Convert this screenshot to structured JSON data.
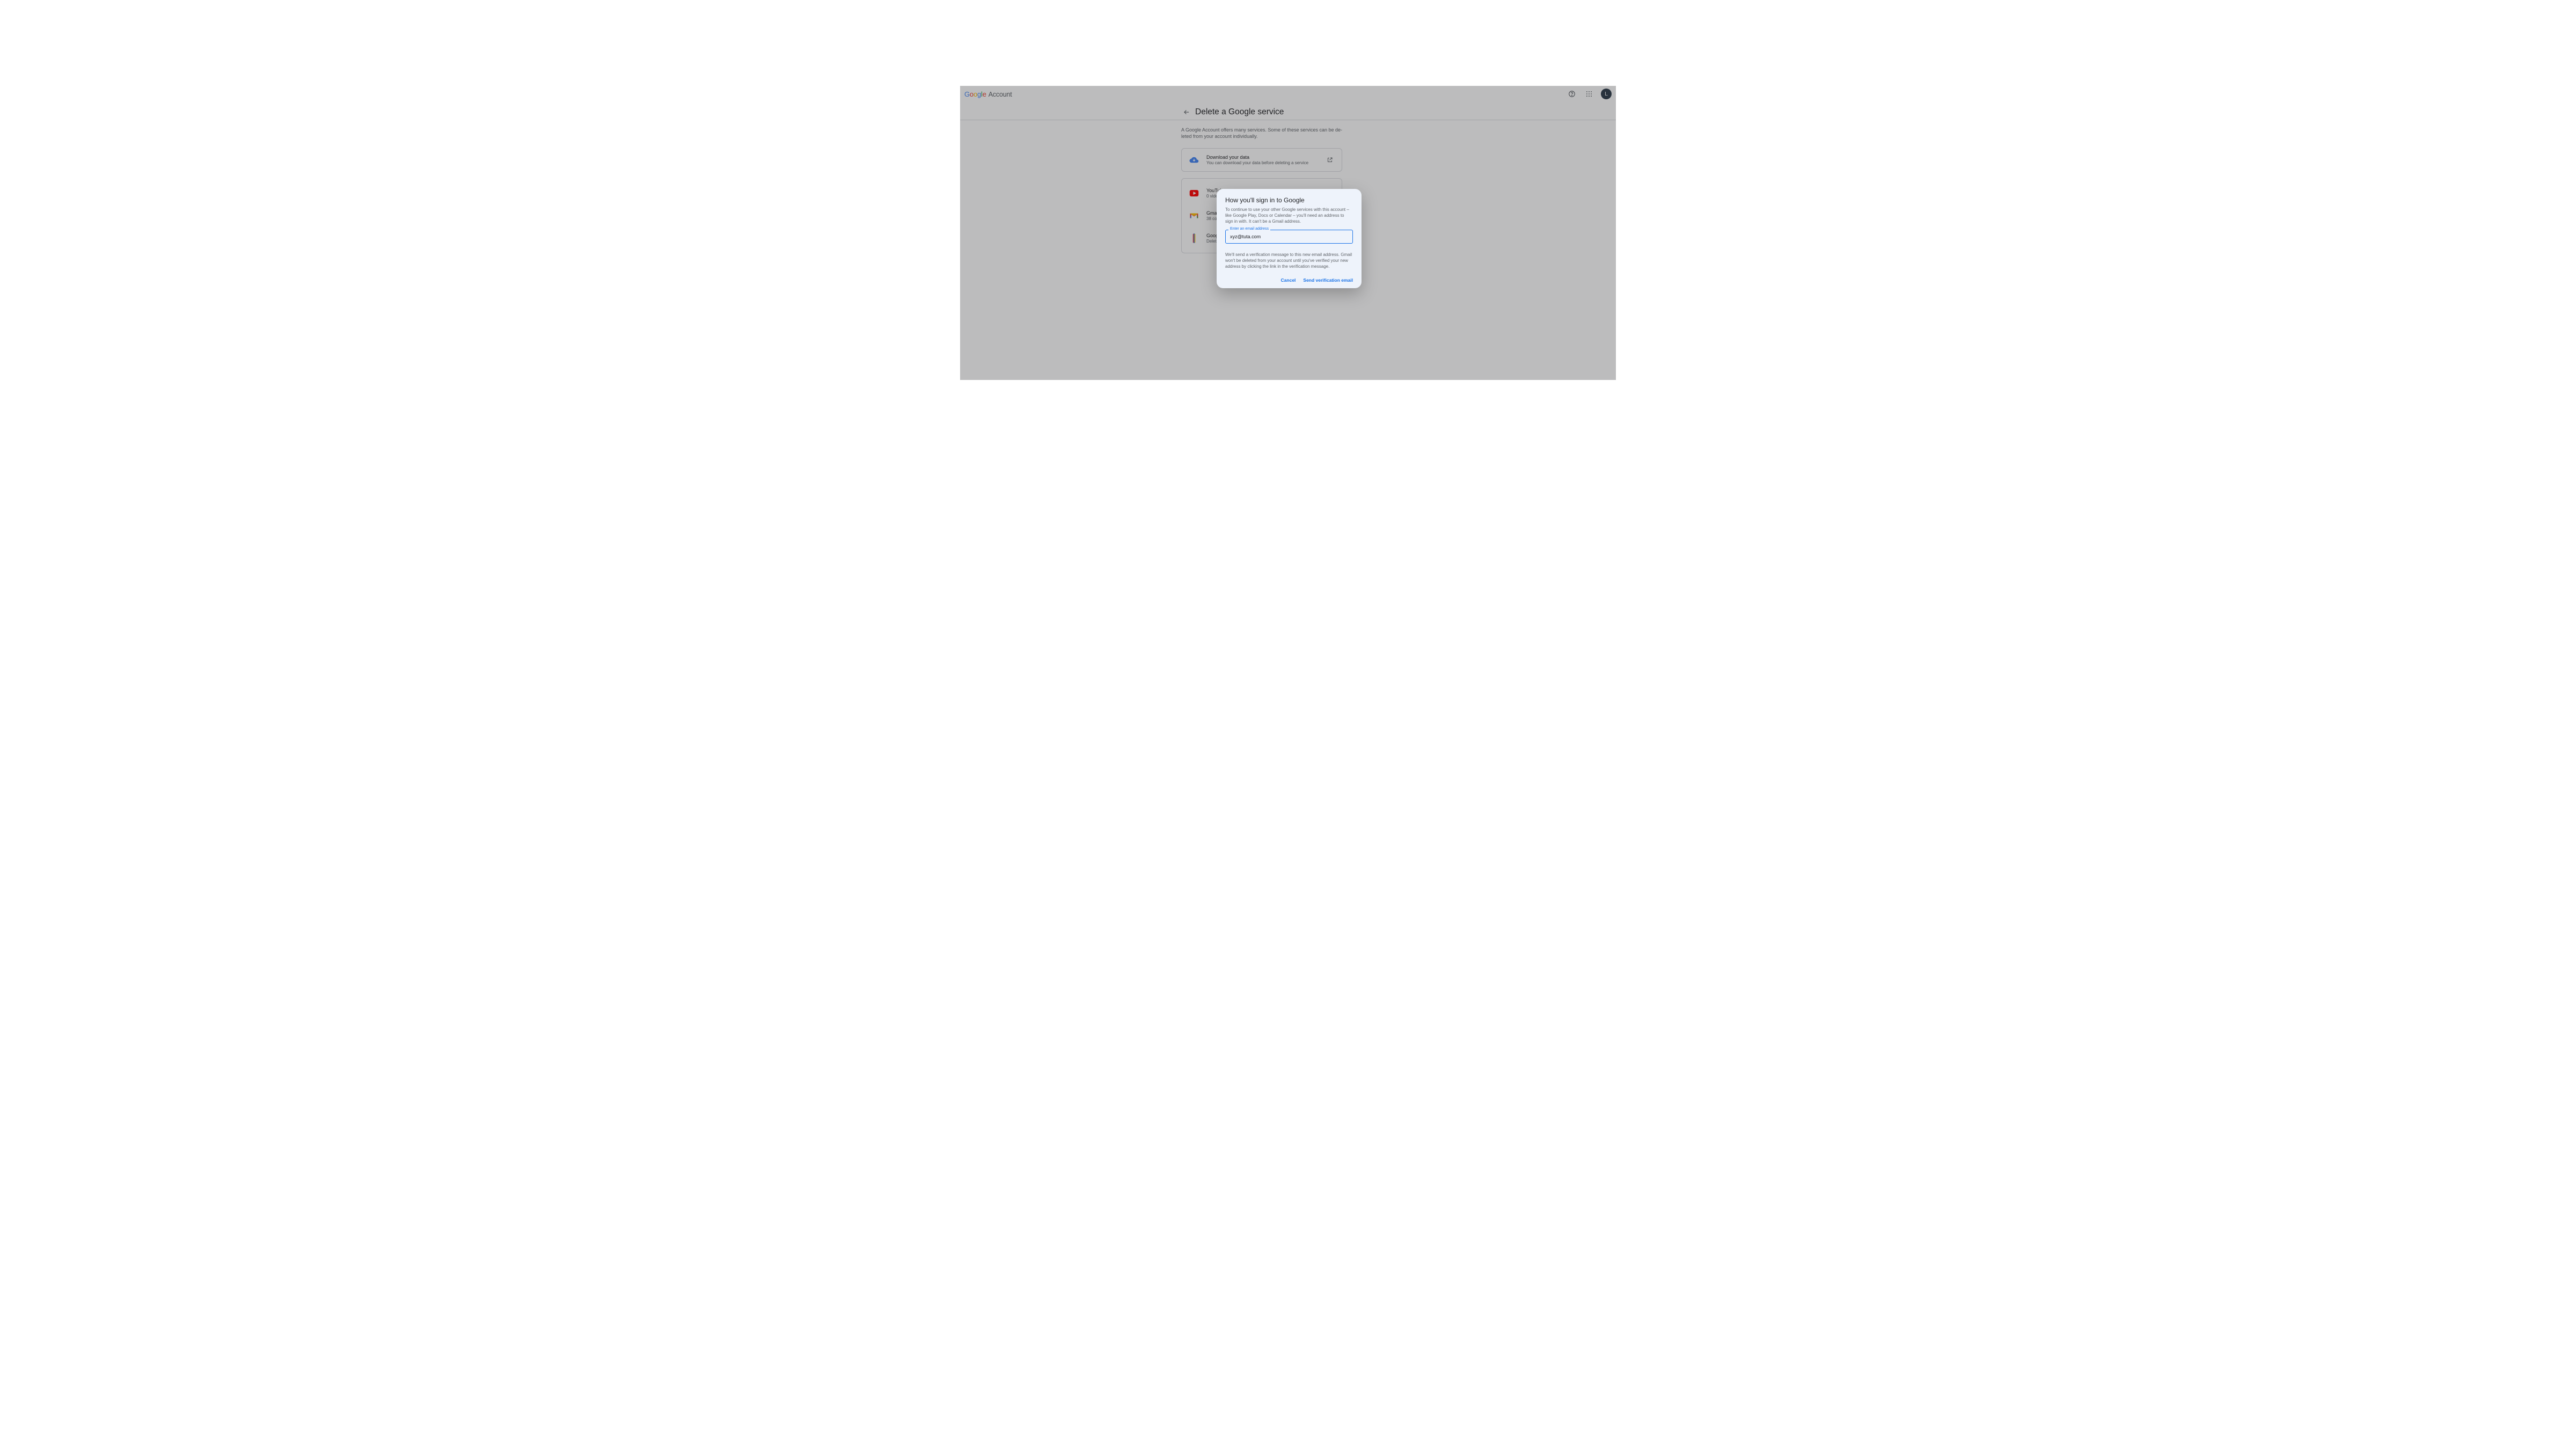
{
  "header": {
    "product": "Account",
    "avatar_letter": "L"
  },
  "page": {
    "title": "Delete a Google service",
    "intro": "A Google Account offers many services. Some of these services can be de­leted from your account individually."
  },
  "download": {
    "title": "Download your data",
    "subtitle": "You can download your data before deleting a service"
  },
  "services": [
    {
      "name": "YouTube",
      "subtitle": "0 videos uploaded"
    },
    {
      "name": "Gmail",
      "subtitle": "38 conversations"
    },
    {
      "name": "Google One",
      "subtitle": "Delete your subscription"
    }
  ],
  "dialog": {
    "title": "How you'll sign in to Google",
    "p1": "To continue to use your other Google services with this account – like Google Play, Docs or Calendar – you'll need an address to sign in with. It can't be a Gmail address.",
    "field_label": "Enter an email address",
    "field_value": "xyz@tuta.com",
    "p2": "We'll send a verification message to this new email address. Gmail won't be deleted from your account until you've verified your new address by clicking the link in the verification message.",
    "cancel": "Cancel",
    "send": "Send verification email"
  }
}
